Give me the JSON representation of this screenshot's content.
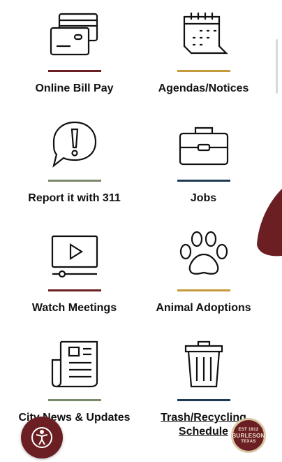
{
  "colors": {
    "maroon": "#6b1f23",
    "gold": "#c49a3a",
    "sage": "#7a8a6a",
    "navy": "#1f3a52"
  },
  "tiles": [
    {
      "label": "Online Bill Pay",
      "icon": "credit-cards-icon",
      "bar_color": "#6b1f23"
    },
    {
      "label": "Agendas/Notices",
      "icon": "calendar-icon",
      "bar_color": "#c49a3a"
    },
    {
      "label": "Report it with 311",
      "icon": "speech-bubble-exclamation-icon",
      "bar_color": "#7a8a6a"
    },
    {
      "label": "Jobs",
      "icon": "briefcase-icon",
      "bar_color": "#1f3a52"
    },
    {
      "label": "Watch Meetings",
      "icon": "video-player-icon",
      "bar_color": "#6b1f23"
    },
    {
      "label": "Animal Adoptions",
      "icon": "paw-print-icon",
      "bar_color": "#c49a3a"
    },
    {
      "label": "City News & Updates",
      "icon": "newspaper-icon",
      "bar_color": "#7a8a6a"
    },
    {
      "label": "Trash/Recycling Schedule",
      "icon": "trash-can-icon",
      "bar_color": "#1f3a52"
    }
  ],
  "seal": {
    "line1": "EST 1912",
    "line2": "BURLESON",
    "line3": "TEXAS"
  }
}
